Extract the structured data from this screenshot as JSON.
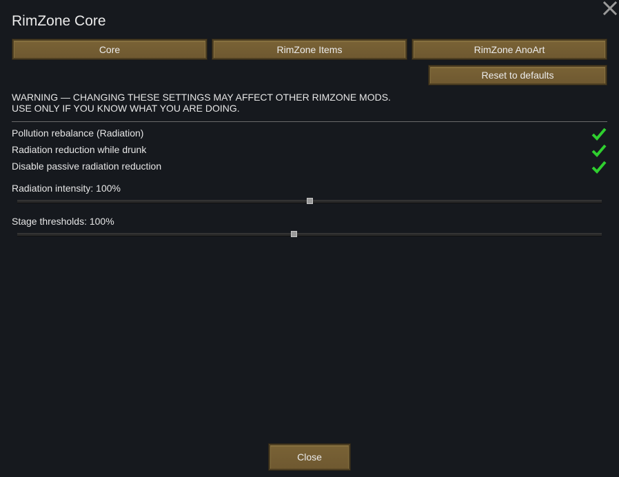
{
  "window": {
    "title": "RimZone Core"
  },
  "tabs": [
    {
      "label": "Core"
    },
    {
      "label": "RimZone Items"
    },
    {
      "label": "RimZone AnoArt"
    }
  ],
  "reset_label": "Reset to defaults",
  "warning": {
    "line1": "WARNING — CHANGING THESE SETTINGS MAY AFFECT OTHER RIMZONE MODS.",
    "line2": "USE ONLY IF YOU KNOW WHAT YOU ARE DOING."
  },
  "toggles": [
    {
      "label": "Pollution rebalance (Radiation)",
      "checked": true
    },
    {
      "label": "Radiation reduction while drunk",
      "checked": true
    },
    {
      "label": "Disable passive radiation reduction",
      "checked": true
    }
  ],
  "sliders": [
    {
      "label": "Radiation intensity: 100%",
      "value_fraction": 0.5
    },
    {
      "label": "Stage thresholds: 100%",
      "value_fraction": 0.474
    }
  ],
  "close_label": "Close",
  "colors": {
    "button": "#7a6336",
    "check": "#2fcf2f",
    "background": "#16191e"
  },
  "icons": {
    "close": "close-icon",
    "check": "checkmark-icon"
  }
}
